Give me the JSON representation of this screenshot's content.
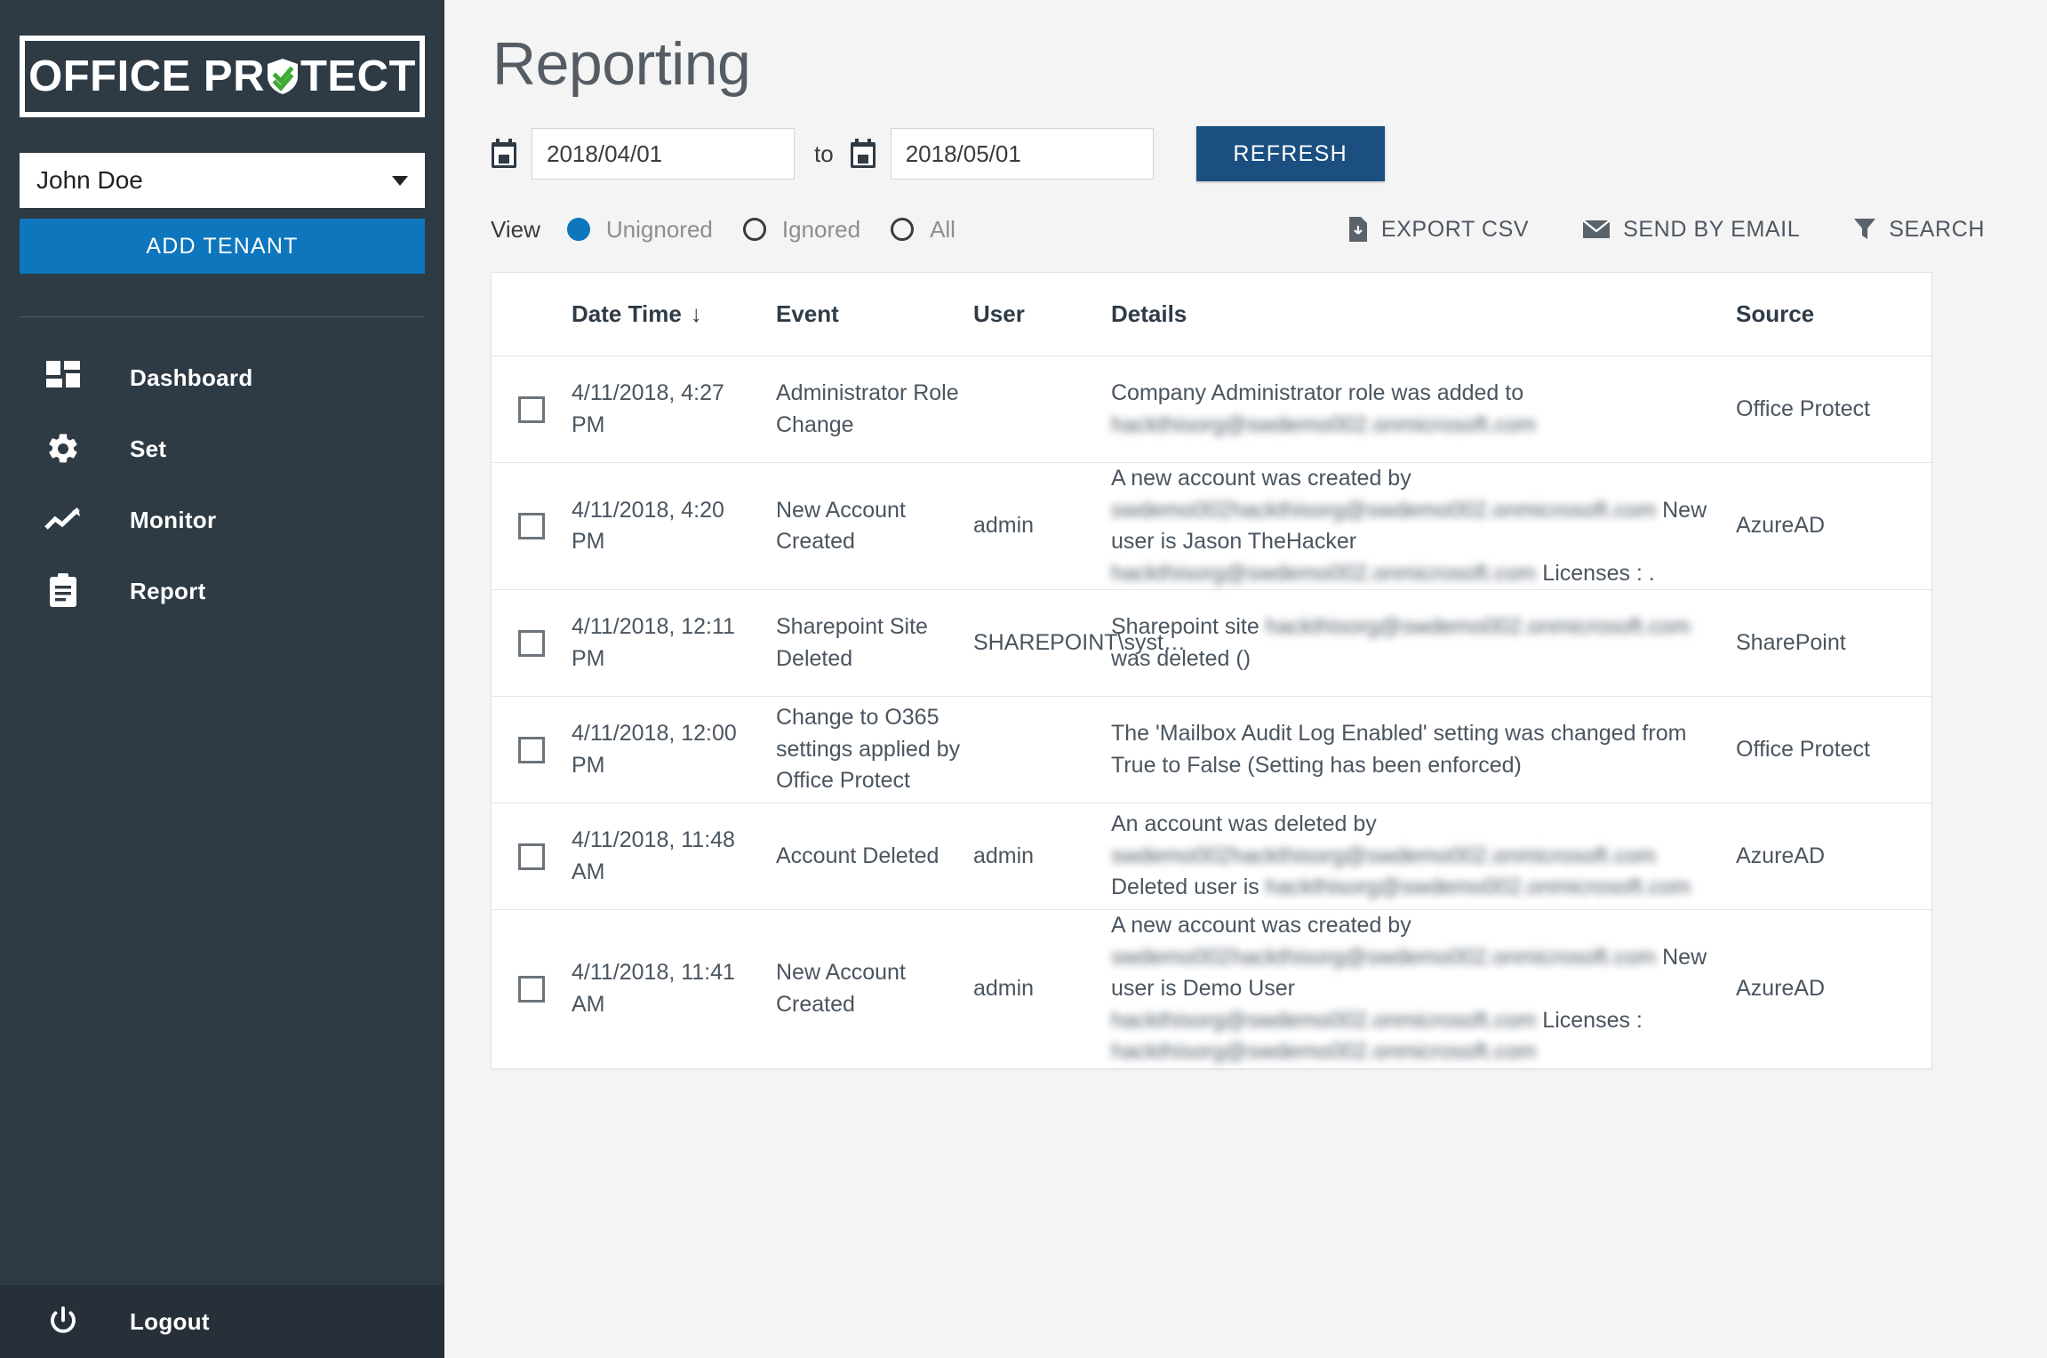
{
  "sidebar": {
    "logo": {
      "part1": "OFFICE PR",
      "shield_icon": "shield-check-icon",
      "part2": "TECT"
    },
    "tenant": {
      "selected": "John Doe",
      "caret_icon": "chevron-down-icon"
    },
    "add_tenant_label": "ADD TENANT",
    "items": [
      {
        "label": "Dashboard",
        "icon": "dashboard-grid-icon"
      },
      {
        "label": "Set",
        "icon": "gear-icon"
      },
      {
        "label": "Monitor",
        "icon": "line-chart-icon"
      },
      {
        "label": "Report",
        "icon": "clipboard-icon"
      }
    ],
    "logout": {
      "label": "Logout",
      "icon": "power-icon"
    }
  },
  "header": {
    "title": "Reporting"
  },
  "filters": {
    "calendar_icon": "calendar-icon",
    "date_from": "2018/04/01",
    "date_to": "2018/05/01",
    "to_label": "to",
    "refresh_label": "REFRESH",
    "view_label": "View",
    "radios": [
      {
        "label": "Unignored",
        "selected": true
      },
      {
        "label": "Ignored",
        "selected": false
      },
      {
        "label": "All",
        "selected": false
      }
    ]
  },
  "actions": [
    {
      "label": "EXPORT CSV",
      "icon": "file-export-icon"
    },
    {
      "label": "SEND BY EMAIL",
      "icon": "envelope-icon"
    },
    {
      "label": "SEARCH",
      "icon": "filter-funnel-icon"
    }
  ],
  "table": {
    "columns": [
      "Date Time",
      "Event",
      "User",
      "Details",
      "Source"
    ],
    "sort_column": "Date Time",
    "sort_arrow": "↓",
    "rows": [
      {
        "checked": false,
        "date_time": "4/11/2018, 4:27 PM",
        "event": "Administrator Role Change",
        "user": "",
        "details": [
          {
            "text": "Company Administrator role was added to ",
            "redacted": false
          },
          {
            "text": "hackthisorg@swdemo002.onmicrosoft.com",
            "redacted": true
          }
        ],
        "source": "Office Protect"
      },
      {
        "checked": false,
        "date_time": "4/11/2018, 4:20 PM",
        "event": "New Account Created",
        "user": "admin",
        "details": [
          {
            "text": "A new account was created by ",
            "redacted": false
          },
          {
            "text": "swdemo002",
            "redacted": true
          },
          {
            "text": "hackthisorg@swdemo002.onmicrosoft.com",
            "redacted": true
          },
          {
            "text": " New user is Jason TheHacker ",
            "redacted": false
          },
          {
            "text": "hackthisorg@swdemo002.onmicrosoft.com",
            "redacted": true
          },
          {
            "text": " Licenses : .",
            "redacted": false
          }
        ],
        "source": "AzureAD"
      },
      {
        "checked": false,
        "date_time": "4/11/2018, 12:11 PM",
        "event": "Sharepoint Site Deleted",
        "user": "SHAREPOINT\\syst…",
        "details": [
          {
            "text": "Sharepoint site ",
            "redacted": false
          },
          {
            "text": "hackthisorg@swdemo002.onmicrosoft.com",
            "redacted": true
          },
          {
            "text": " was deleted ()",
            "redacted": false
          }
        ],
        "source": "SharePoint"
      },
      {
        "checked": false,
        "date_time": "4/11/2018, 12:00 PM",
        "event": "Change to O365 settings applied by Office Protect",
        "user": "",
        "details": [
          {
            "text": "The 'Mailbox Audit Log Enabled' setting was changed from True to False (Setting has been enforced)",
            "redacted": false
          }
        ],
        "source": "Office Protect"
      },
      {
        "checked": false,
        "date_time": "4/11/2018, 11:48 AM",
        "event": "Account Deleted",
        "user": "admin",
        "details": [
          {
            "text": "An account was deleted by ",
            "redacted": false
          },
          {
            "text": "swdemo002",
            "redacted": true
          },
          {
            "text": "hackthisorg@swdemo002.onmicrosoft.com",
            "redacted": true
          },
          {
            "text": " Deleted user is ",
            "redacted": false
          },
          {
            "text": "hackthisorg@swdemo002.onmicrosoft.com",
            "redacted": true
          }
        ],
        "source": "AzureAD"
      },
      {
        "checked": false,
        "date_time": "4/11/2018, 11:41 AM",
        "event": "New Account Created",
        "user": "admin",
        "details": [
          {
            "text": "A new account was created by ",
            "redacted": false
          },
          {
            "text": "swdemo002",
            "redacted": true
          },
          {
            "text": "hackthisorg@swdemo002.onmicrosoft.com",
            "redacted": true
          },
          {
            "text": " New user is Demo User ",
            "redacted": false
          },
          {
            "text": "hackthisorg@swdemo002.onmicrosoft.com",
            "redacted": true
          },
          {
            "text": " Licenses : ",
            "redacted": false
          },
          {
            "text": "hackthisorg@swdemo002.onmicrosoft.com",
            "redacted": true
          }
        ],
        "source": "AzureAD"
      }
    ]
  },
  "colors": {
    "sidebar_bg": "#2e3a44",
    "accent_blue": "#0d76bd",
    "refresh_blue": "#1b4f80",
    "page_bg": "#f4f4f4",
    "logo_check_green": "#3faa35"
  }
}
